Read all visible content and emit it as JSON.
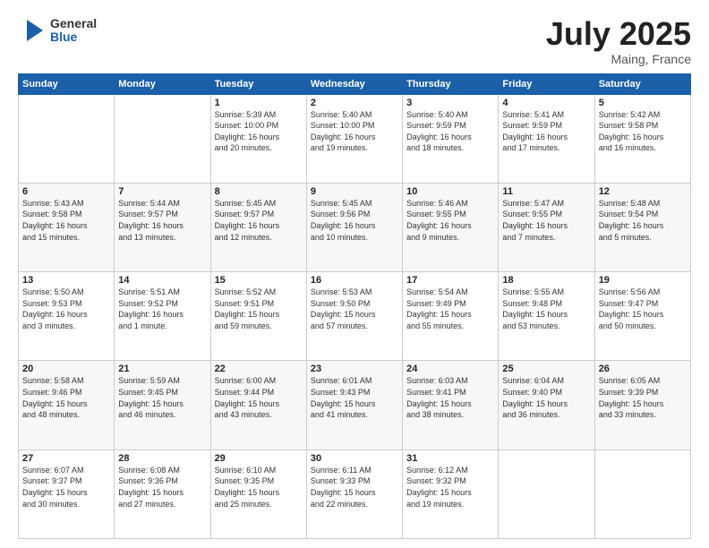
{
  "header": {
    "logo_general": "General",
    "logo_blue": "Blue",
    "month": "July 2025",
    "location": "Maing, France"
  },
  "weekdays": [
    "Sunday",
    "Monday",
    "Tuesday",
    "Wednesday",
    "Thursday",
    "Friday",
    "Saturday"
  ],
  "weeks": [
    [
      {
        "day": "",
        "info": ""
      },
      {
        "day": "",
        "info": ""
      },
      {
        "day": "1",
        "info": "Sunrise: 5:39 AM\nSunset: 10:00 PM\nDaylight: 16 hours\nand 20 minutes."
      },
      {
        "day": "2",
        "info": "Sunrise: 5:40 AM\nSunset: 10:00 PM\nDaylight: 16 hours\nand 19 minutes."
      },
      {
        "day": "3",
        "info": "Sunrise: 5:40 AM\nSunset: 9:59 PM\nDaylight: 16 hours\nand 18 minutes."
      },
      {
        "day": "4",
        "info": "Sunrise: 5:41 AM\nSunset: 9:59 PM\nDaylight: 16 hours\nand 17 minutes."
      },
      {
        "day": "5",
        "info": "Sunrise: 5:42 AM\nSunset: 9:58 PM\nDaylight: 16 hours\nand 16 minutes."
      }
    ],
    [
      {
        "day": "6",
        "info": "Sunrise: 5:43 AM\nSunset: 9:58 PM\nDaylight: 16 hours\nand 15 minutes."
      },
      {
        "day": "7",
        "info": "Sunrise: 5:44 AM\nSunset: 9:57 PM\nDaylight: 16 hours\nand 13 minutes."
      },
      {
        "day": "8",
        "info": "Sunrise: 5:45 AM\nSunset: 9:57 PM\nDaylight: 16 hours\nand 12 minutes."
      },
      {
        "day": "9",
        "info": "Sunrise: 5:45 AM\nSunset: 9:56 PM\nDaylight: 16 hours\nand 10 minutes."
      },
      {
        "day": "10",
        "info": "Sunrise: 5:46 AM\nSunset: 9:55 PM\nDaylight: 16 hours\nand 9 minutes."
      },
      {
        "day": "11",
        "info": "Sunrise: 5:47 AM\nSunset: 9:55 PM\nDaylight: 16 hours\nand 7 minutes."
      },
      {
        "day": "12",
        "info": "Sunrise: 5:48 AM\nSunset: 9:54 PM\nDaylight: 16 hours\nand 5 minutes."
      }
    ],
    [
      {
        "day": "13",
        "info": "Sunrise: 5:50 AM\nSunset: 9:53 PM\nDaylight: 16 hours\nand 3 minutes."
      },
      {
        "day": "14",
        "info": "Sunrise: 5:51 AM\nSunset: 9:52 PM\nDaylight: 16 hours\nand 1 minute."
      },
      {
        "day": "15",
        "info": "Sunrise: 5:52 AM\nSunset: 9:51 PM\nDaylight: 15 hours\nand 59 minutes."
      },
      {
        "day": "16",
        "info": "Sunrise: 5:53 AM\nSunset: 9:50 PM\nDaylight: 15 hours\nand 57 minutes."
      },
      {
        "day": "17",
        "info": "Sunrise: 5:54 AM\nSunset: 9:49 PM\nDaylight: 15 hours\nand 55 minutes."
      },
      {
        "day": "18",
        "info": "Sunrise: 5:55 AM\nSunset: 9:48 PM\nDaylight: 15 hours\nand 53 minutes."
      },
      {
        "day": "19",
        "info": "Sunrise: 5:56 AM\nSunset: 9:47 PM\nDaylight: 15 hours\nand 50 minutes."
      }
    ],
    [
      {
        "day": "20",
        "info": "Sunrise: 5:58 AM\nSunset: 9:46 PM\nDaylight: 15 hours\nand 48 minutes."
      },
      {
        "day": "21",
        "info": "Sunrise: 5:59 AM\nSunset: 9:45 PM\nDaylight: 15 hours\nand 46 minutes."
      },
      {
        "day": "22",
        "info": "Sunrise: 6:00 AM\nSunset: 9:44 PM\nDaylight: 15 hours\nand 43 minutes."
      },
      {
        "day": "23",
        "info": "Sunrise: 6:01 AM\nSunset: 9:43 PM\nDaylight: 15 hours\nand 41 minutes."
      },
      {
        "day": "24",
        "info": "Sunrise: 6:03 AM\nSunset: 9:41 PM\nDaylight: 15 hours\nand 38 minutes."
      },
      {
        "day": "25",
        "info": "Sunrise: 6:04 AM\nSunset: 9:40 PM\nDaylight: 15 hours\nand 36 minutes."
      },
      {
        "day": "26",
        "info": "Sunrise: 6:05 AM\nSunset: 9:39 PM\nDaylight: 15 hours\nand 33 minutes."
      }
    ],
    [
      {
        "day": "27",
        "info": "Sunrise: 6:07 AM\nSunset: 9:37 PM\nDaylight: 15 hours\nand 30 minutes."
      },
      {
        "day": "28",
        "info": "Sunrise: 6:08 AM\nSunset: 9:36 PM\nDaylight: 15 hours\nand 27 minutes."
      },
      {
        "day": "29",
        "info": "Sunrise: 6:10 AM\nSunset: 9:35 PM\nDaylight: 15 hours\nand 25 minutes."
      },
      {
        "day": "30",
        "info": "Sunrise: 6:11 AM\nSunset: 9:33 PM\nDaylight: 15 hours\nand 22 minutes."
      },
      {
        "day": "31",
        "info": "Sunrise: 6:12 AM\nSunset: 9:32 PM\nDaylight: 15 hours\nand 19 minutes."
      },
      {
        "day": "",
        "info": ""
      },
      {
        "day": "",
        "info": ""
      }
    ]
  ]
}
